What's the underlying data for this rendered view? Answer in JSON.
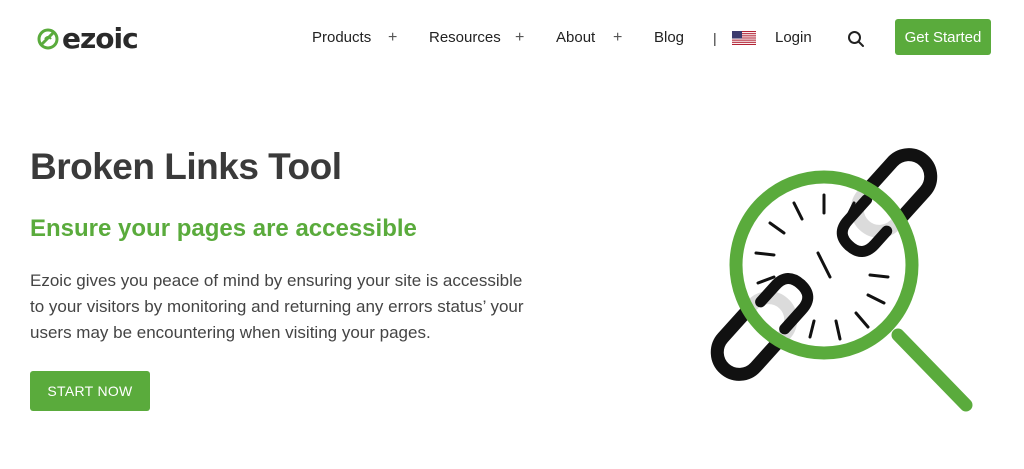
{
  "brand": {
    "name": "ezoic",
    "accent": "#5aab3c"
  },
  "nav": {
    "items": [
      {
        "label": "Products",
        "has_plus": true
      },
      {
        "label": "Resources",
        "has_plus": true
      },
      {
        "label": "About",
        "has_plus": true
      },
      {
        "label": "Blog",
        "has_plus": false
      }
    ],
    "separator": "|",
    "flag_icon": "us-flag-icon",
    "login_label": "Login",
    "search_icon": "search-icon",
    "cta_label": "Get Started"
  },
  "hero": {
    "title": "Broken Links Tool",
    "subtitle": "Ensure your pages are accessible",
    "body": "Ezoic gives you peace of mind by ensuring your site is accessible to your visitors by monitoring and returning any errors status’ your users may be encountering when visiting your pages.",
    "button_label": "START NOW",
    "illustration_icon": "broken-link-magnifier-icon"
  }
}
